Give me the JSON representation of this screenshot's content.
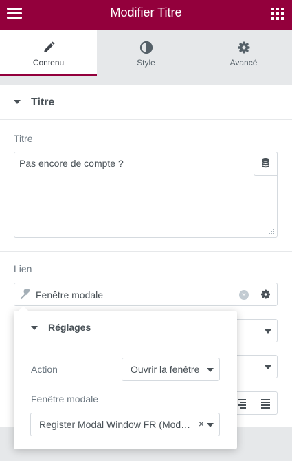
{
  "header": {
    "title": "Modifier Titre"
  },
  "tabs": [
    {
      "label": "Contenu",
      "icon": "pencil-icon"
    },
    {
      "label": "Style",
      "icon": "half-circle-icon"
    },
    {
      "label": "Avancé",
      "icon": "gear-icon"
    }
  ],
  "section": {
    "title": "Titre"
  },
  "title_field": {
    "label": "Titre",
    "value": "Pas encore de compte ?"
  },
  "link_field": {
    "label": "Lien",
    "value": "Fenêtre modale"
  },
  "popup": {
    "title": "Réglages",
    "action_label": "Action",
    "action_value": "Ouvrir la fenêtre",
    "modal_label": "Fenêtre modale",
    "modal_value": "Register Modal Window FR (Mod…"
  },
  "colors": {
    "brand": "#93003c"
  }
}
